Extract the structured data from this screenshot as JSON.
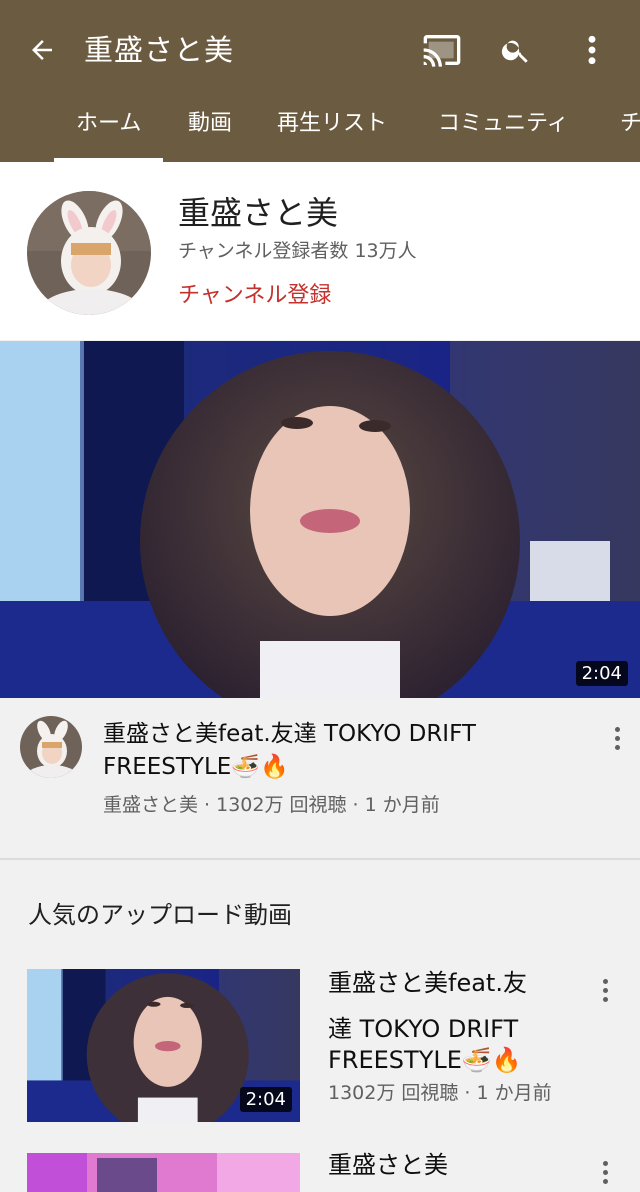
{
  "header": {
    "title": "重盛さと美",
    "back_icon": "arrow-left-icon",
    "cast_icon": "cast-icon",
    "search_icon": "search-icon",
    "more_icon": "more-vert-icon"
  },
  "tabs": [
    {
      "label": "ホーム",
      "active": true
    },
    {
      "label": "動画"
    },
    {
      "label": "再生リスト"
    },
    {
      "label": "コミュニティ"
    },
    {
      "label": "チ"
    }
  ],
  "channel": {
    "name": "重盛さと美",
    "subscribers": "チャンネル登録者数 13万人",
    "subscribe_label": "チャンネル登録"
  },
  "featured": {
    "duration": "2:04",
    "title": "重盛さと美feat.友達 TOKYO DRIFT FREESTYLE🍜🔥",
    "meta": "重盛さと美 · 1302万 回視聴 · 1 か月前"
  },
  "popular": {
    "section_title": "人気のアップロード動画",
    "items": [
      {
        "title_line1": "重盛さと美feat.友",
        "title_line2": "達 TOKYO DRIFT",
        "title_line3": "FREESTYLE🍜🔥",
        "meta": "1302万 回視聴 · 1 か月前",
        "duration": "2:04"
      },
      {
        "title_line1": "重盛さと美"
      }
    ]
  },
  "colors": {
    "header_bg": "#6b5b41",
    "subscribe": "#c4302b"
  }
}
